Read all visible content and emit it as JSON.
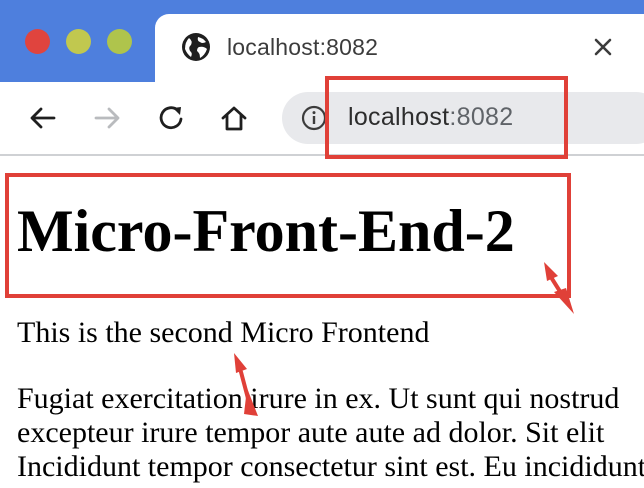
{
  "browser": {
    "tab": {
      "title": "localhost:8082",
      "favicon": "globe-icon",
      "close_icon": "close-icon"
    },
    "toolbar": {
      "back_icon": "arrow-left-icon",
      "forward_icon": "arrow-right-icon",
      "reload_icon": "reload-icon",
      "home_icon": "home-icon"
    },
    "omnibox": {
      "info_icon": "info-icon",
      "host": "localhost",
      "port": ":8082"
    },
    "colors": {
      "titlebar": "#4e7fdd",
      "close_dot": "#e0443e",
      "minimize_dot": "#c1c84f",
      "zoom_dot": "#afc44c"
    }
  },
  "page": {
    "title": "Micro-Front-End-2",
    "subtitle": "This is the second Micro Frontend",
    "paragraph_lines": [
      "Fugiat exercitation irure in ex. Ut sunt qui nostrud",
      "excepteur irure tempor aute aute ad dolor. Sit elit",
      "Incididunt tempor consectetur sint est. Eu incididunt"
    ]
  },
  "annotations": {
    "highlight_color": "#e04038"
  }
}
